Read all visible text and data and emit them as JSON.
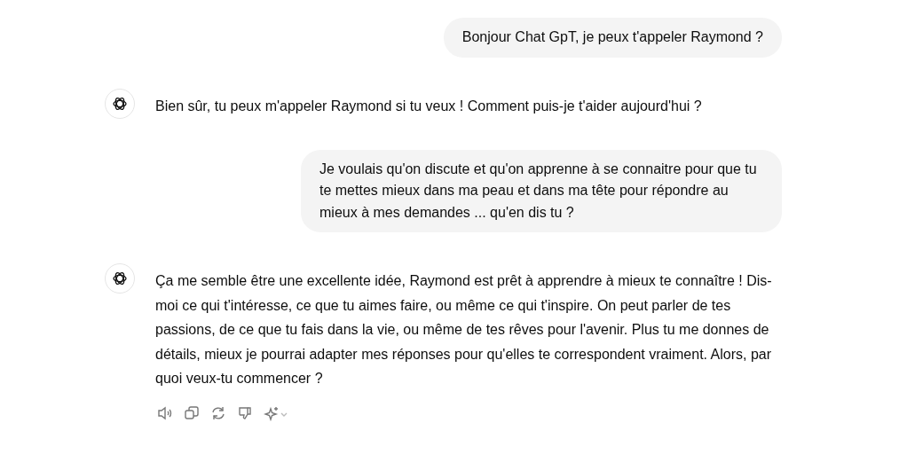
{
  "messages": [
    {
      "kind": "user",
      "text": "Bonjour Chat GpT, je peux t'appeler Raymond ?",
      "actions": false
    },
    {
      "kind": "assistant",
      "text": "Bien sûr, tu peux m'appeler Raymond si tu veux ! Comment puis-je t'aider aujourd'hui ?",
      "actions": false
    },
    {
      "kind": "user",
      "text": "Je voulais qu'on discute et qu'on apprenne à se connaitre pour que tu te mettes mieux dans ma peau et dans ma tête pour répondre au mieux à mes demandes ... qu'en dis tu ?",
      "actions": false
    },
    {
      "kind": "assistant",
      "text": "Ça me semble être une excellente idée, Raymond est prêt à apprendre à mieux te connaître ! Dis-moi ce qui t'intéresse, ce que tu aimes faire, ou même ce qui t'inspire. On peut parler de tes passions, de ce que tu fais dans la vie, ou même de tes rêves pour l'avenir. Plus tu me donnes de détails, mieux je pourrai adapter mes réponses pour qu'elles te correspondent vraiment. Alors, par quoi veux-tu commencer ?",
      "actions": true
    }
  ]
}
